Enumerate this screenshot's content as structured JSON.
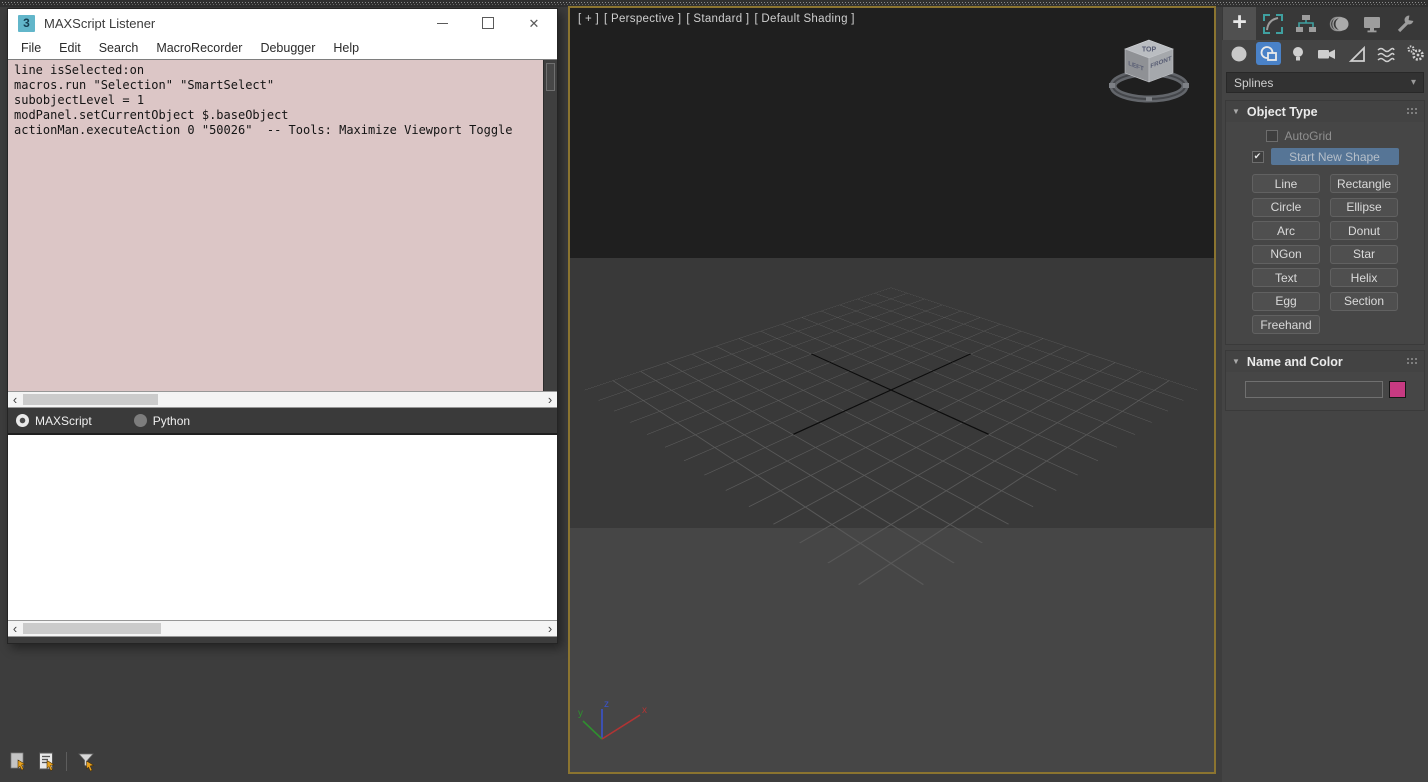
{
  "glyphs": {
    "close": "✕",
    "scroll_left": "‹",
    "scroll_right": "›",
    "dropdown_caret": "▾",
    "rollout_arrow": "▼",
    "check": "✔",
    "plus": "+"
  },
  "listener": {
    "icon_label": "3",
    "title": "MAXScript Listener",
    "menus": [
      "File",
      "Edit",
      "Search",
      "MacroRecorder",
      "Debugger",
      "Help"
    ],
    "code_lines": [
      "line isSelected:on",
      "macros.run \"Selection\" \"SmartSelect\"",
      "subobjectLevel = 1",
      "modPanel.setCurrentObject $.baseObject",
      "actionMan.executeAction 0 \"50026\"  -- Tools: Maximize Viewport Toggle"
    ],
    "languages": [
      {
        "label": "MAXScript",
        "selected": true
      },
      {
        "label": "Python",
        "selected": false
      }
    ]
  },
  "viewport": {
    "border_color": "#8b7430",
    "labels": [
      "[ + ]",
      "[ Perspective ]",
      "[ Standard ]",
      "[ Default Shading ]"
    ],
    "viewcube": {
      "top": "TOP",
      "left": "LEFT",
      "front": "FRONT"
    },
    "axis_labels": {
      "x": "x",
      "y": "y",
      "z": "z"
    },
    "axis_colors": {
      "x": "#b13434",
      "y": "#2f8f2f",
      "z": "#3953cc"
    }
  },
  "command_panel": {
    "tabs": [
      {
        "name": "create",
        "active": true
      },
      {
        "name": "modify",
        "active": false
      },
      {
        "name": "hierarchy",
        "active": false
      },
      {
        "name": "motion",
        "active": false
      },
      {
        "name": "display",
        "active": false
      },
      {
        "name": "utilities",
        "active": false
      }
    ],
    "categories": [
      {
        "name": "geometry",
        "active": false
      },
      {
        "name": "shapes",
        "active": true
      },
      {
        "name": "lights",
        "active": false
      },
      {
        "name": "cameras",
        "active": false
      },
      {
        "name": "helpers",
        "active": false
      },
      {
        "name": "space-warps",
        "active": false
      },
      {
        "name": "systems",
        "active": false
      }
    ],
    "category_active_color": "#4a82c8",
    "subcategory": "Splines",
    "object_type": {
      "title": "Object Type",
      "autogrid": {
        "label": "AutoGrid",
        "checked": false
      },
      "start_new_shape": {
        "label": "Start New Shape",
        "checked": true
      },
      "buttons": [
        "Line",
        "Rectangle",
        "Circle",
        "Ellipse",
        "Arc",
        "Donut",
        "NGon",
        "Star",
        "Text",
        "Helix",
        "Egg",
        "Section",
        "Freehand"
      ]
    },
    "name_and_color": {
      "title": "Name and Color",
      "name_value": "",
      "swatch_color": "#c73a82"
    }
  },
  "status_icons": [
    "scene-explorer",
    "layer-explorer",
    "selection-filter"
  ]
}
